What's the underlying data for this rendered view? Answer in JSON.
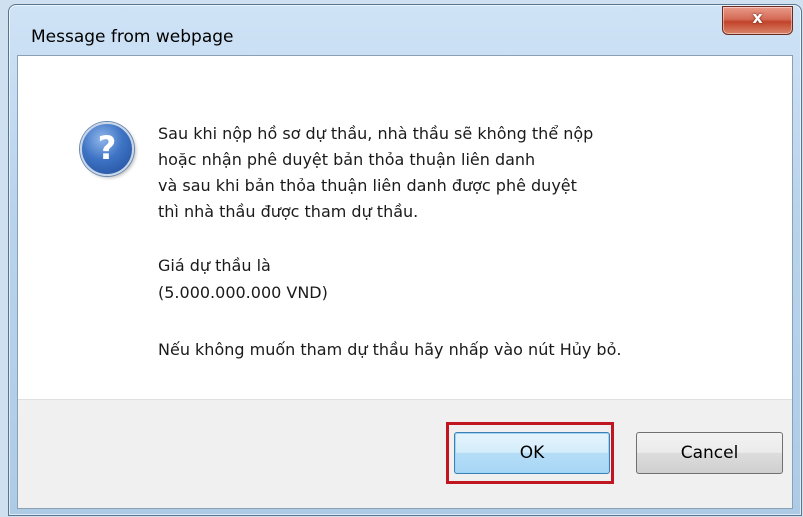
{
  "window": {
    "title": "Message from webpage",
    "close_label": "x"
  },
  "dialog": {
    "icon": "question-icon",
    "icon_glyph": "?",
    "lines": [
      "Sau khi nộp hồ sơ dự thầu, nhà thầu sẽ không thể nộp",
      "hoặc nhận phê duyệt bản thỏa thuận liên danh",
      "và sau khi bản thỏa thuận liên danh được phê duyệt",
      "thì nhà thầu được tham dự thầu.",
      "Giá dự thầu là",
      "(5.000.000.000 VND)",
      "Nếu không muốn tham dự thầu hãy nhấp vào nút Hủy bỏ."
    ]
  },
  "buttons": {
    "ok_label": "OK",
    "cancel_label": "Cancel"
  },
  "colors": {
    "highlight": "#c0161f",
    "close": "#c2432a"
  }
}
